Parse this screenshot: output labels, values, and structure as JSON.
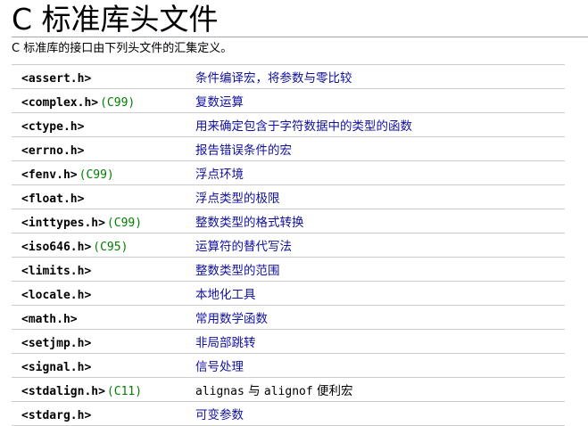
{
  "page": {
    "title": "C 标准库头文件",
    "intro": "C 标准库的接口由下列头文件的汇集定义。"
  },
  "colors": {
    "link": "#11119e",
    "since": "#008000",
    "rule": "#a2a9b1",
    "row_border": "#cccccc"
  },
  "headers": [
    {
      "name": "<assert.h>",
      "since": "",
      "desc": "条件编译宏，将参数与零比较"
    },
    {
      "name": "<complex.h>",
      "since": "(C99)",
      "desc": "复数运算"
    },
    {
      "name": "<ctype.h>",
      "since": "",
      "desc": "用来确定包含于字符数据中的类型的函数"
    },
    {
      "name": "<errno.h>",
      "since": "",
      "desc": "报告错误条件的宏"
    },
    {
      "name": "<fenv.h>",
      "since": "(C99)",
      "desc": "浮点环境"
    },
    {
      "name": "<float.h>",
      "since": "",
      "desc": "浮点类型的极限"
    },
    {
      "name": "<inttypes.h>",
      "since": "(C99)",
      "desc": "整数类型的格式转换"
    },
    {
      "name": "<iso646.h>",
      "since": "(C95)",
      "desc": "运算符的替代写法"
    },
    {
      "name": "<limits.h>",
      "since": "",
      "desc": "整数类型的范围"
    },
    {
      "name": "<locale.h>",
      "since": "",
      "desc": "本地化工具"
    },
    {
      "name": "<math.h>",
      "since": "",
      "desc": "常用数学函数"
    },
    {
      "name": "<setjmp.h>",
      "since": "",
      "desc": "非局部跳转"
    },
    {
      "name": "<signal.h>",
      "since": "",
      "desc": "信号处理"
    },
    {
      "name": "<stdalign.h>",
      "since": "(C11)",
      "desc_parts": {
        "code1": "alignas",
        "mid": " 与 ",
        "code2": "alignof",
        "tail": " 便利宏"
      }
    },
    {
      "name": "<stdarg.h>",
      "since": "",
      "desc": "可变参数"
    }
  ]
}
